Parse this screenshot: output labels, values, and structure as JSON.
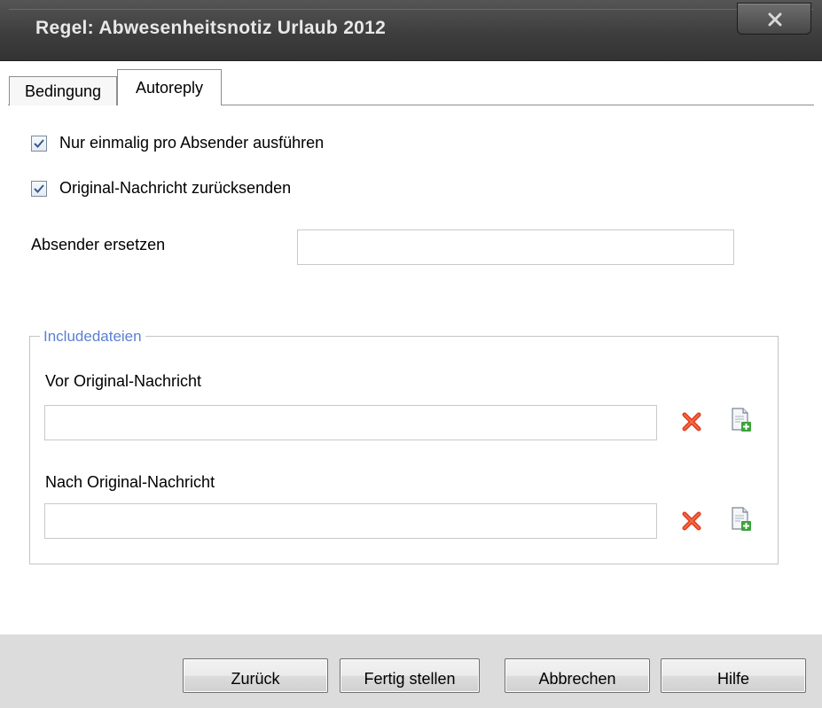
{
  "window": {
    "title": "Regel: Abwesenheitsnotiz Urlaub 2012",
    "close_label": "X"
  },
  "tabs": [
    {
      "label": "Bedingung",
      "selected": false
    },
    {
      "label": "Autoreply",
      "selected": true
    }
  ],
  "options": {
    "once_per_sender": {
      "label": "Nur einmalig pro Absender ausführen",
      "checked": true
    },
    "return_original": {
      "label": "Original-Nachricht zurücksenden",
      "checked": true
    }
  },
  "sender_replace": {
    "label": "Absender ersetzen",
    "value": ""
  },
  "include_files": {
    "legend": "Includedateien",
    "before": {
      "label": "Vor Original-Nachricht",
      "value": ""
    },
    "after": {
      "label": "Nach Original-Nachricht",
      "value": ""
    }
  },
  "buttons": {
    "back": "Zurück",
    "finish": "Fertig stellen",
    "cancel": "Abbrechen",
    "help": "Hilfe"
  },
  "icons": {
    "delete": "red-x-delete-icon",
    "add_file": "document-add-icon"
  },
  "colors": {
    "titlebar": "#3e3e3e",
    "legend_text": "#5b7fd0",
    "delete_icon": "#e03a1c",
    "add_icon": "#3aa33a",
    "footer": "#dcdcdc"
  }
}
